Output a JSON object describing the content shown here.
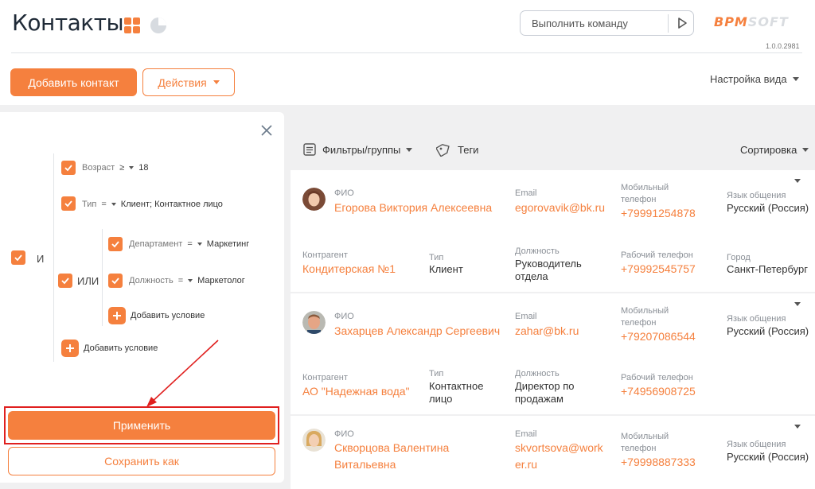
{
  "header": {
    "title": "Контакты",
    "command_placeholder": "Выполнить команду",
    "logo_bpm": "BPM",
    "logo_soft": "SOFT",
    "version": "1.0.0.2981"
  },
  "actions": {
    "add_contact": "Добавить контакт",
    "actions": "Действия",
    "view_setup": "Настройка вида"
  },
  "filter": {
    "root_logic": "И",
    "conditions": [
      {
        "field": "Возраст",
        "op": "≥",
        "value": "18"
      },
      {
        "field": "Тип",
        "op": "=",
        "value": "Клиент; Контактное лицо"
      }
    ],
    "group_logic": "ИЛИ",
    "group_conditions": [
      {
        "field": "Департамент",
        "op": "=",
        "value": "Маркетинг"
      },
      {
        "field": "Должность",
        "op": "=",
        "value": "Маркетолог"
      }
    ],
    "add_condition": "Добавить условие",
    "apply": "Применить",
    "save_as": "Сохранить как"
  },
  "list_toolbar": {
    "filters": "Фильтры/группы",
    "tags": "Теги",
    "sort": "Сортировка"
  },
  "labels": {
    "fio": "ФИО",
    "email": "Email",
    "mobile_1": "Мобильный",
    "mobile_2": "телефон",
    "language": "Язык общения",
    "account": "Контрагент",
    "type": "Тип",
    "position": "Должность",
    "work_phone": "Рабочий телефон",
    "city": "Город"
  },
  "contacts": [
    {
      "name": "Егорова Виктория Алексеевна",
      "email": "egorovavik@bk.ru",
      "mobile": "+79991254878",
      "language": "Русский (Россия)",
      "account": "Кондитерская №1",
      "type": "Клиент",
      "position_1": "Руководитель",
      "position_2": "отдела",
      "work_phone": "+79992545757",
      "city": "Санкт-Петербург"
    },
    {
      "name": "Захарцев Александр Сергеевич",
      "email": "zahar@bk.ru",
      "mobile": "+79207086544",
      "language": "Русский (Россия)",
      "account": "АО \"Надежная вода\"",
      "type_1": "Контактное",
      "type_2": "лицо",
      "position_1": "Директор по",
      "position_2": "продажам",
      "work_phone": "+74956908725"
    },
    {
      "name_1": "Скворцова Валентина",
      "name_2": "Витальевна",
      "email_1": "skvortsova@work",
      "email_2": "er.ru",
      "mobile": "+79998887333",
      "language": "Русский (Россия)"
    }
  ],
  "colors": {
    "accent": "#f5803e",
    "highlight": "#e0201f"
  }
}
